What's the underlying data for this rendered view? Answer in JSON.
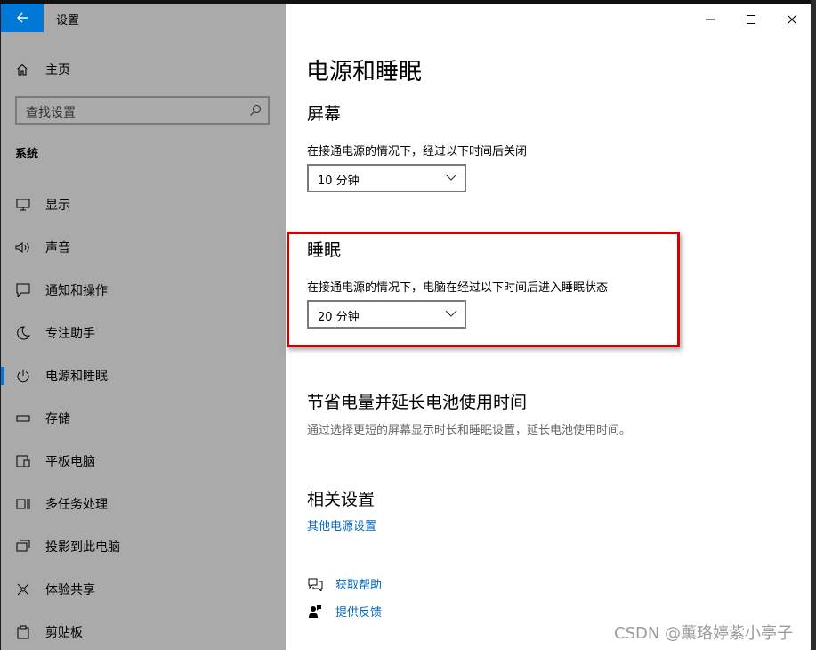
{
  "app": {
    "title": "设置"
  },
  "sidebar": {
    "home_label": "主页",
    "search_placeholder": "查找设置",
    "section": "系统",
    "items": [
      {
        "label": "显示",
        "icon": "monitor-icon"
      },
      {
        "label": "声音",
        "icon": "speaker-icon"
      },
      {
        "label": "通知和操作",
        "icon": "notification-icon"
      },
      {
        "label": "专注助手",
        "icon": "moon-icon"
      },
      {
        "label": "电源和睡眠",
        "icon": "power-icon",
        "active": true
      },
      {
        "label": "存储",
        "icon": "storage-icon"
      },
      {
        "label": "平板电脑",
        "icon": "tablet-icon"
      },
      {
        "label": "多任务处理",
        "icon": "multitask-icon"
      },
      {
        "label": "投影到此电脑",
        "icon": "project-icon"
      },
      {
        "label": "体验共享",
        "icon": "share-icon"
      },
      {
        "label": "剪贴板",
        "icon": "clipboard-icon"
      }
    ]
  },
  "main": {
    "title": "电源和睡眠",
    "screen": {
      "heading": "屏幕",
      "description": "在接通电源的情况下，经过以下时间后关闭",
      "value": "10 分钟"
    },
    "sleep": {
      "heading": "睡眠",
      "description": "在接通电源的情况下，电脑在经过以下时间后进入睡眠状态",
      "value": "20 分钟"
    },
    "save": {
      "heading": "节省电量并延长电池使用时间",
      "description": "通过选择更短的屏幕显示时长和睡眠设置，延长电池使用时间。"
    },
    "related": {
      "heading": "相关设置",
      "link": "其他电源设置"
    },
    "help": {
      "get_help": "获取帮助",
      "feedback": "提供反馈"
    }
  },
  "watermark": "CSDN @薰珞婷紫小亭子",
  "colors": {
    "accent": "#0078d7",
    "link": "#0067c0",
    "highlight": "#d40000",
    "sidebar_bg": "#aaaaaa"
  }
}
